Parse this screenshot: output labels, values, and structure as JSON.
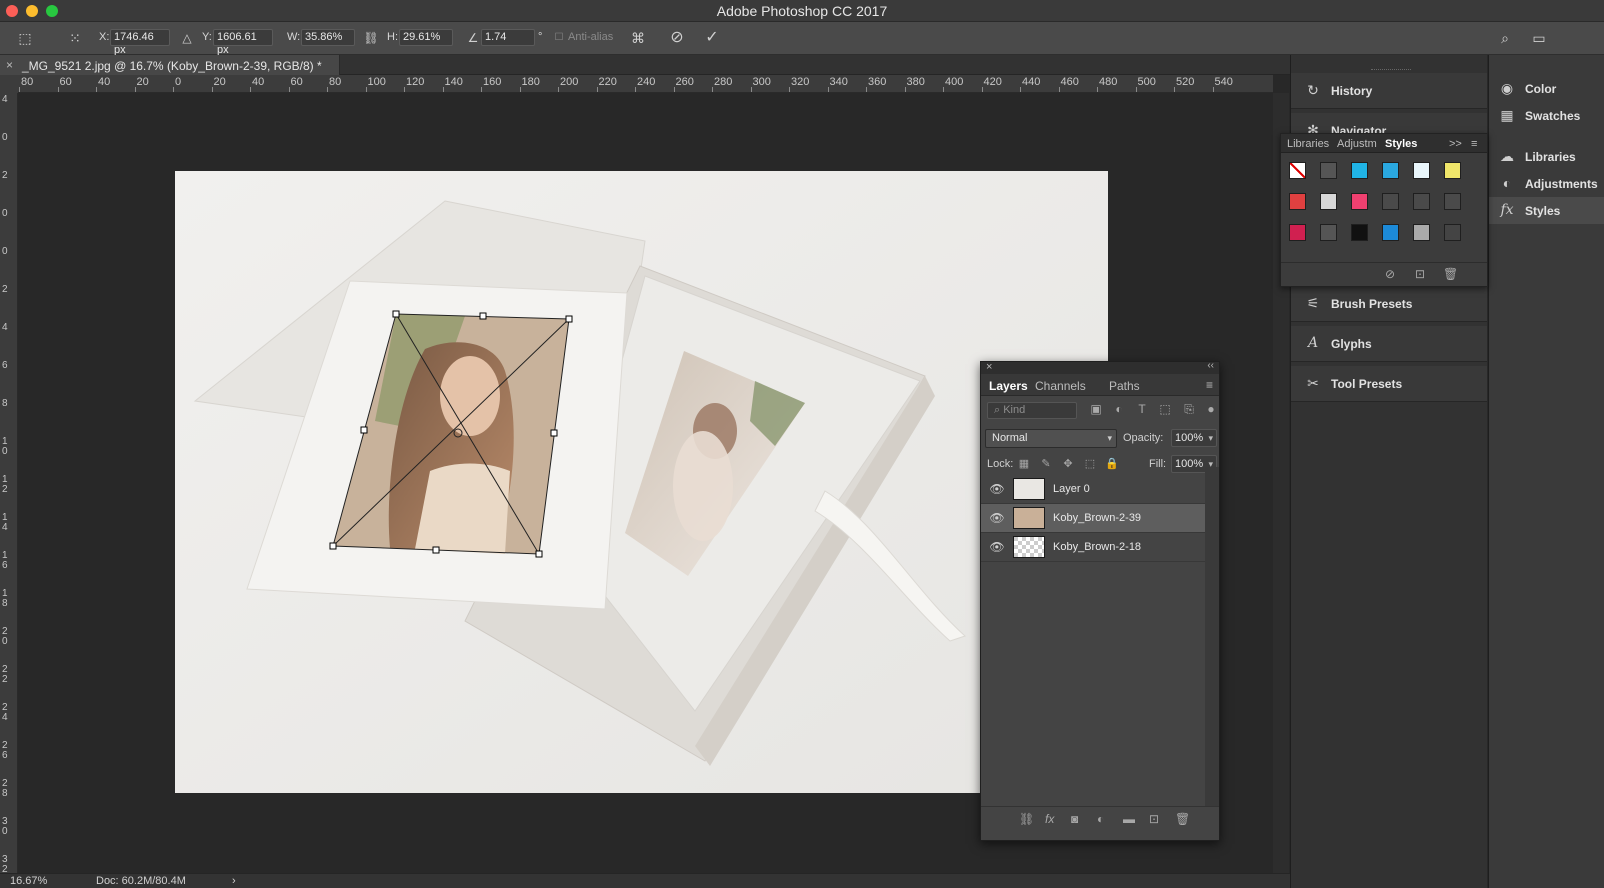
{
  "window": {
    "title": "Adobe Photoshop CC 2017"
  },
  "options_bar": {
    "x_label": "X:",
    "x_value": "1746.46 px",
    "y_label": "Y:",
    "y_value": "1606.61 px",
    "w_label": "W:",
    "w_value": "35.86%",
    "h_label": "H:",
    "h_value": "29.61%",
    "angle_value": "1.74",
    "angle_unit": "°",
    "antialias_label": "Anti-alias",
    "cancel_icon": "cancel-transform-icon",
    "commit_icon": "commit-transform-icon"
  },
  "document": {
    "tab_title": "_MG_9521 2.jpg @ 16.7% (Koby_Brown-2-39, RGB/8) *",
    "close_glyph": "×"
  },
  "ruler": {
    "h_labels": [
      "80",
      "60",
      "40",
      "20",
      "0",
      "20",
      "40",
      "60",
      "80",
      "100",
      "120",
      "140",
      "160",
      "180",
      "200",
      "220",
      "240",
      "260",
      "280",
      "300",
      "320",
      "340",
      "360",
      "380",
      "400",
      "420",
      "440",
      "460",
      "480",
      "500",
      "520",
      "540"
    ],
    "v_labels": [
      "4",
      "0",
      "2",
      "0",
      "0",
      "2",
      "4",
      "6",
      "8",
      "1 0",
      "1 2",
      "1 4",
      "1 6",
      "1 8",
      "2 0",
      "2 2",
      "2 4",
      "2 6",
      "2 8",
      "3 0",
      "3 2"
    ]
  },
  "status": {
    "zoom": "16.67%",
    "doc": "Doc: 60.2M/80.4M",
    "arrow": "›"
  },
  "dock_left": {
    "items": [
      {
        "label": "History",
        "icon": "history-icon"
      },
      {
        "label": "Navigator",
        "icon": "navigator-icon"
      },
      {
        "label": "Brush Presets",
        "icon": "brush-presets-icon"
      },
      {
        "label": "Glyphs",
        "icon": "glyphs-icon"
      },
      {
        "label": "Tool Presets",
        "icon": "tool-presets-icon"
      }
    ]
  },
  "dock_right": {
    "items": [
      {
        "label": "Color",
        "icon": "color-icon"
      },
      {
        "label": "Swatches",
        "icon": "swatches-icon"
      },
      {
        "label": "Libraries",
        "icon": "libraries-icon"
      },
      {
        "label": "Adjustments",
        "icon": "adjustments-icon"
      },
      {
        "label": "Styles",
        "icon": "styles-icon",
        "active": true
      }
    ]
  },
  "styles_panel": {
    "tabs": [
      "Libraries",
      "Adjustm",
      "Styles"
    ],
    "active_tab": "Styles",
    "expand_glyph": ">>",
    "swatch_colors": [
      "#ffffff",
      "#555555",
      "#20b4e6",
      "#2aa8e0",
      "#e9f6fb",
      "#f0e66a",
      "#e04040",
      "#d8d8d8",
      "#f04070",
      "#4a4a4a",
      "#4a4a4a",
      "#4a4a4a",
      "#d02050",
      "#555555",
      "#111111",
      "#1c8ad8",
      "#aaaaaa",
      "#444444"
    ]
  },
  "layers_panel": {
    "tabs": [
      "Layers",
      "Channels",
      "Paths"
    ],
    "active_tab": "Layers",
    "filter_placeholder": "Kind",
    "blend_mode": "Normal",
    "opacity_label": "Opacity:",
    "opacity_value": "100%",
    "lock_label": "Lock:",
    "fill_label": "Fill:",
    "fill_value": "100%",
    "layers": [
      {
        "name": "Layer 0",
        "selected": false
      },
      {
        "name": "Koby_Brown-2-39",
        "selected": true
      },
      {
        "name": "Koby_Brown-2-18",
        "selected": false
      }
    ]
  },
  "colors": {
    "accent_selected_row": "#5e5e5e",
    "panel_bg": "#444444",
    "app_bg": "#282828"
  }
}
